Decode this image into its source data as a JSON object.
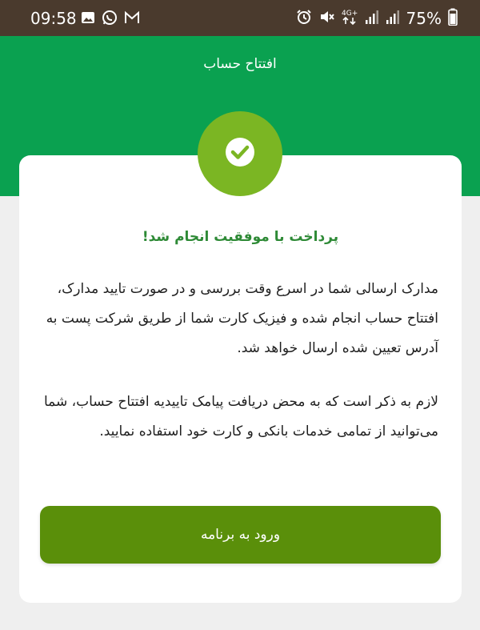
{
  "status_bar": {
    "time": "09:58",
    "battery": "75%",
    "network": "4G+"
  },
  "header": {
    "title": "افتتاح حساب"
  },
  "content": {
    "success_title": "پرداخت با موفقیت انجام شد!",
    "paragraph_1": "مدارک ارسالی شما در اسرع وقت بررسی و در صورت تایید مدارک، افتتاح حساب انجام شده و فیزیک کارت شما از طریق شرکت پست به آدرس تعیین شده ارسال خواهد شد.",
    "paragraph_2": "لازم به ذکر است که به محض دریافت پیامک تاییدیه افتتاح حساب، شما می‌توانید از تمامی خدمات بانکی و کارت خود استفاده نمایید.",
    "button_label": "ورود به برنامه"
  },
  "colors": {
    "status_bar_bg": "#4a3a2d",
    "header_green": "#0aa150",
    "badge_green": "#7bb623",
    "title_green": "#2e8a36",
    "button_green": "#5a8f0a",
    "page_bg": "#efefef"
  },
  "icons": {
    "status_left": [
      "gallery-icon",
      "whatsapp-icon",
      "gmail-icon"
    ],
    "status_right": [
      "alarm-icon",
      "mute-icon",
      "network-4g-icon",
      "signal-icon",
      "signal-icon",
      "battery-icon"
    ],
    "badge": "checkmark-icon"
  }
}
